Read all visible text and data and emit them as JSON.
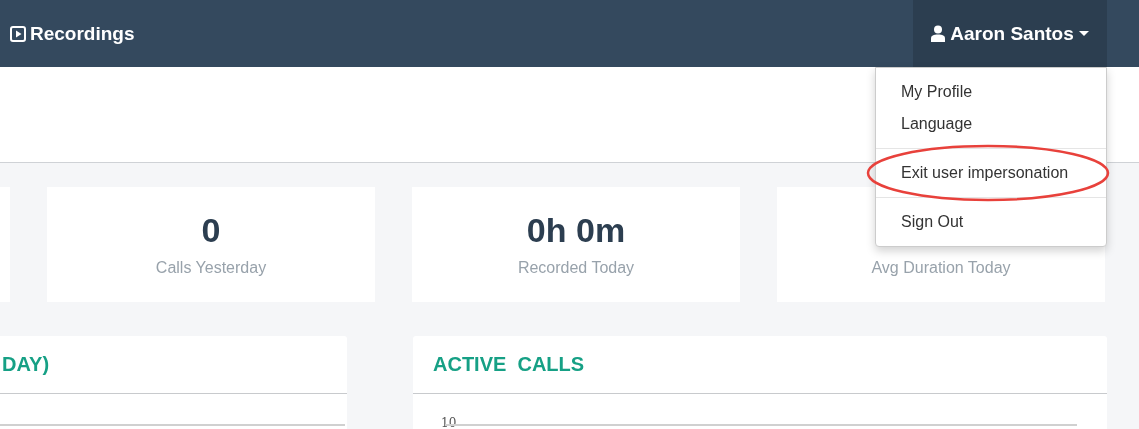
{
  "navbar": {
    "brand": "Recordings",
    "user_menu": {
      "label": "Aaron Santos",
      "expanded": true
    }
  },
  "user_dropdown": {
    "groups": [
      [
        {
          "label": "My Profile",
          "highlighted": false
        },
        {
          "label": "Language",
          "highlighted": false
        }
      ],
      [
        {
          "label": "Exit user impersonation",
          "highlighted": true
        }
      ],
      [
        {
          "label": "Sign Out",
          "highlighted": false
        }
      ]
    ]
  },
  "stats": [
    {
      "value": "0",
      "label": "Calls Yesterday"
    },
    {
      "value": "0h 0m",
      "label": "Recorded Today"
    },
    {
      "label": "Avg Duration Today"
    }
  ],
  "panels": [
    {
      "title": "DAY)"
    },
    {
      "title": "ACTIVE  CALLS",
      "y_tick": "10"
    }
  ]
}
